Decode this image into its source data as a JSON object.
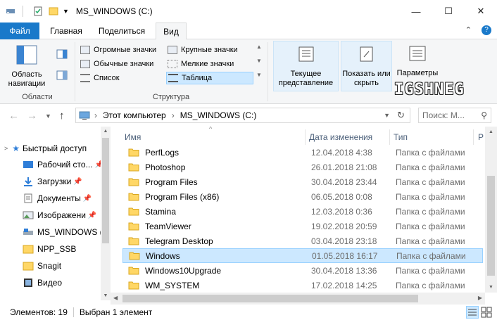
{
  "window": {
    "title": "MS_WINDOWS (C:)",
    "minimize_glyph": "—",
    "maximize_glyph": "☐",
    "close_glyph": "✕"
  },
  "ribbon_tabs": {
    "file": "Файл",
    "home": "Главная",
    "share": "Поделиться",
    "view": "Вид",
    "collapse_glyph": "⌃",
    "help_glyph": "?"
  },
  "ribbon": {
    "panes_button": "Область навигации",
    "panes_group": "Области",
    "layout_items": {
      "extra_large": "Огромные значки",
      "large": "Крупные значки",
      "medium": "Обычные значки",
      "small": "Мелкие значки",
      "list": "Список",
      "details": "Таблица"
    },
    "layout_group": "Структура",
    "current_view": "Текущее представление",
    "show_hide": "Показать или скрыть",
    "options": "Параметры"
  },
  "watermark": "IGSHNEG",
  "address": {
    "computer": "Этот компьютер",
    "drive": "MS_WINDOWS (C:)",
    "separator": "›"
  },
  "search": {
    "placeholder": "Поиск: М..."
  },
  "nav_pane": {
    "items": [
      {
        "label": "Быстрый доступ",
        "pinned": false
      },
      {
        "label": "Рабочий сто...",
        "pinned": true
      },
      {
        "label": "Загрузки",
        "pinned": true
      },
      {
        "label": "Документы",
        "pinned": true
      },
      {
        "label": "Изображени",
        "pinned": true
      },
      {
        "label": "MS_WINDOWS (",
        "pinned": false
      },
      {
        "label": "NPP_SSB",
        "pinned": false
      },
      {
        "label": "Snagit",
        "pinned": false
      },
      {
        "label": "Видео",
        "pinned": false
      }
    ],
    "pin_glyph": "📌"
  },
  "columns": {
    "name": "Имя",
    "date": "Дата изменения",
    "type": "Тип",
    "size": "Р"
  },
  "files": [
    {
      "name": "PerfLogs",
      "date": "12.04.2018 4:38",
      "type": "Папка с файлами"
    },
    {
      "name": "Photoshop",
      "date": "26.01.2018 21:08",
      "type": "Папка с файлами"
    },
    {
      "name": "Program Files",
      "date": "30.04.2018 23:44",
      "type": "Папка с файлами"
    },
    {
      "name": "Program Files (x86)",
      "date": "06.05.2018 0:08",
      "type": "Папка с файлами"
    },
    {
      "name": "Stamina",
      "date": "12.03.2018 0:36",
      "type": "Папка с файлами"
    },
    {
      "name": "TeamViewer",
      "date": "19.02.2018 20:59",
      "type": "Папка с файлами"
    },
    {
      "name": "Telegram Desktop",
      "date": "03.04.2018 23:18",
      "type": "Папка с файлами"
    },
    {
      "name": "Windows",
      "date": "01.05.2018 16:17",
      "type": "Папка с файлами"
    },
    {
      "name": "Windows10Upgrade",
      "date": "30.04.2018 13:36",
      "type": "Папка с файлами"
    },
    {
      "name": "WM_SYSTEM",
      "date": "17.02.2018 14:25",
      "type": "Папка с файлами"
    }
  ],
  "selected_index": 7,
  "status": {
    "count": "Элементов: 19",
    "selected": "Выбран 1 элемент"
  },
  "colors": {
    "accent": "#1979ca",
    "selection": "#cce8ff",
    "folder": "#ffd766"
  }
}
